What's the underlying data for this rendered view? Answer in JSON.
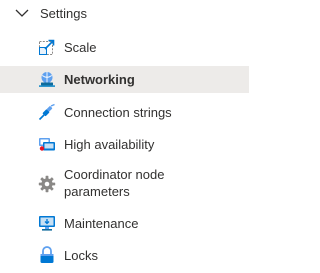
{
  "group": {
    "label": "Settings",
    "expanded": true
  },
  "items": [
    {
      "label": "Scale",
      "icon": "scale-icon",
      "selected": false
    },
    {
      "label": "Networking",
      "icon": "networking-icon",
      "selected": true
    },
    {
      "label": "Connection strings",
      "icon": "connection-strings-icon",
      "selected": false
    },
    {
      "label": "High availability",
      "icon": "high-availability-icon",
      "selected": false
    },
    {
      "label": "Coordinator node parameters",
      "icon": "gear-icon",
      "selected": false
    },
    {
      "label": "Maintenance",
      "icon": "maintenance-icon",
      "selected": false
    },
    {
      "label": "Locks",
      "icon": "lock-icon",
      "selected": false
    }
  ],
  "colors": {
    "selected_bg": "#edebe9",
    "text": "#323130",
    "accent_blue": "#0078d4"
  }
}
